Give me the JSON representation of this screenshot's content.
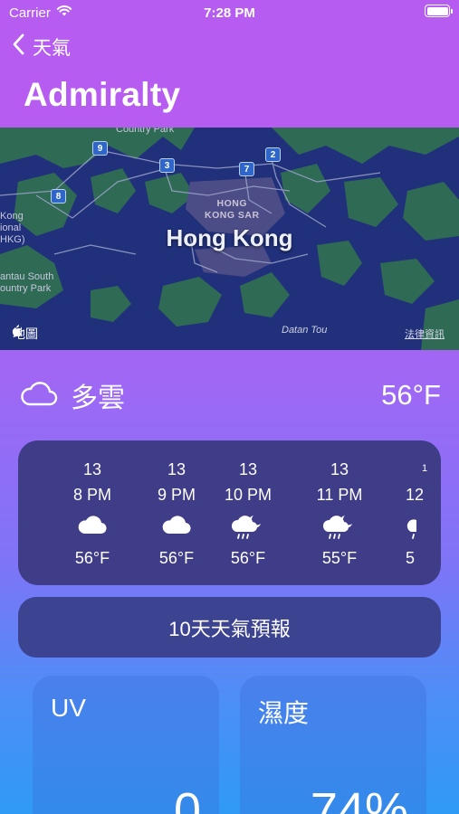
{
  "status_bar": {
    "carrier": "Carrier",
    "time": "7:28 PM",
    "battery_level": 1.0
  },
  "nav": {
    "back_label": "天氣",
    "title": "Admiralty"
  },
  "map": {
    "city": "Hong Kong",
    "district_line1": "HONG",
    "district_line2": "KONG SAR",
    "labels": {
      "country_park": "Country Park",
      "kong": "Kong",
      "ional": "ional",
      "hkg": "HKG)",
      "lantau1": "antau South",
      "lantau2": "ountry Park",
      "datan": "Datan Tou"
    },
    "route_badges": [
      "9",
      "3",
      "7",
      "2",
      "8"
    ],
    "attribution": "地圖",
    "legal": "法律資訊"
  },
  "current": {
    "condition": "多雲",
    "temperature": "56°F",
    "icon": "cloud-outline-icon"
  },
  "hourly": [
    {
      "date": "13",
      "time": "8 PM",
      "icon": "cloud-icon",
      "temp": "56°F"
    },
    {
      "date": "13",
      "time": "9 PM",
      "icon": "cloud-icon",
      "temp": "56°F"
    },
    {
      "date": "13",
      "time": "10 PM",
      "icon": "cloud-moon-rain-icon",
      "temp": "56°F"
    },
    {
      "date": "13",
      "time": "11 PM",
      "icon": "cloud-moon-rain-icon",
      "temp": "55°F"
    },
    {
      "date": "1",
      "time": "12",
      "icon": "cloud-moon-rain-icon",
      "temp": "5"
    }
  ],
  "forecast_button": "10天天氣預報",
  "tiles": {
    "uv": {
      "title": "UV",
      "value": "0"
    },
    "humidity": {
      "title": "濕度",
      "value": "74%"
    }
  },
  "colors": {
    "header": "#b65cf0",
    "card": "#3f3c88",
    "map_water": "#21307a",
    "map_land": "#2f6a55"
  }
}
